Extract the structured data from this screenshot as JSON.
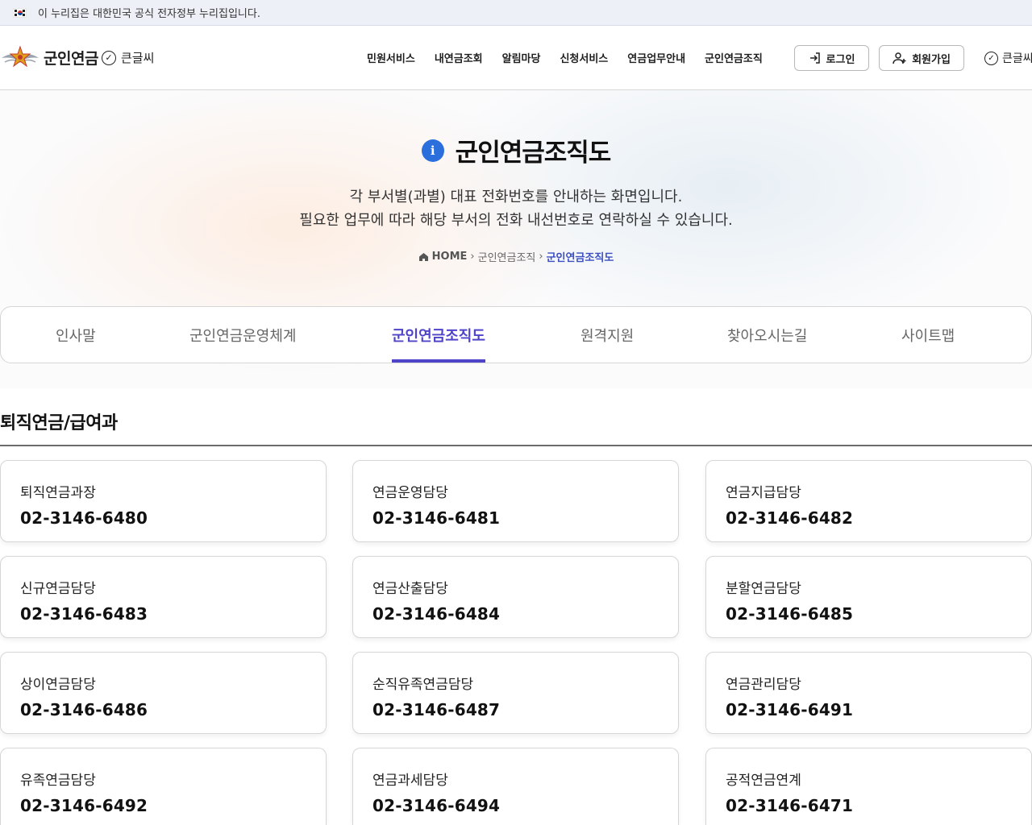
{
  "gov_banner": {
    "text": "이 누리집은 대한민국 공식 전자정부 누리집입니다."
  },
  "header": {
    "logo_text": "군인연금",
    "big_font_label": "큰글씨",
    "nav": [
      "민원서비스",
      "내연금조회",
      "알림마당",
      "신청서비스",
      "연금업무안내",
      "군인연금조직"
    ],
    "login_label": "로그인",
    "signup_label": "회원가입",
    "big_font_label_right": "큰글씨"
  },
  "hero": {
    "title": "군인연금조직도",
    "desc_line1": "각 부서별(과별) 대표 전화번호를 안내하는 화면입니다.",
    "desc_line2": "필요한 업무에 따라 해당 부서의 전화 내선번호로 연락하실 수 있습니다.",
    "breadcrumb": {
      "home": "HOME",
      "parent": "군인연금조직",
      "current": "군인연금조직도"
    }
  },
  "tabs": {
    "items": [
      "인사말",
      "군인연금운영체계",
      "군인연금조직도",
      "원격지원",
      "찾아오시는길",
      "사이트맵"
    ],
    "active_index": 2
  },
  "section": {
    "title": "퇴직연금/급여과",
    "cards": [
      {
        "name": "퇴직연금과장",
        "phone": "02-3146-6480"
      },
      {
        "name": "연금운영담당",
        "phone": "02-3146-6481"
      },
      {
        "name": "연금지급담당",
        "phone": "02-3146-6482"
      },
      {
        "name": "신규연금담당",
        "phone": "02-3146-6483"
      },
      {
        "name": "연금산출담당",
        "phone": "02-3146-6484"
      },
      {
        "name": "분할연금담당",
        "phone": "02-3146-6485"
      },
      {
        "name": "상이연금담당",
        "phone": "02-3146-6486"
      },
      {
        "name": "순직유족연금담당",
        "phone": "02-3146-6487"
      },
      {
        "name": "연금관리담당",
        "phone": "02-3146-6491"
      },
      {
        "name": "유족연금담당",
        "phone": "02-3146-6492"
      },
      {
        "name": "연금과세담당",
        "phone": "02-3146-6494"
      },
      {
        "name": "공적연금연계",
        "phone": "02-3146-6471"
      }
    ]
  },
  "colors": {
    "accent": "#4f44c9",
    "info_blue": "#2b6fdc",
    "gov_bar": "#eef0f8"
  }
}
